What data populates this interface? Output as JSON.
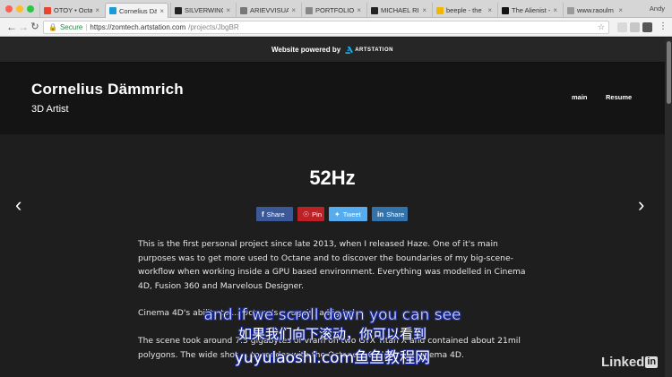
{
  "browser": {
    "tabs": [
      {
        "label": "OTOY • Octa",
        "favicon_color": "#e8452c"
      },
      {
        "label": "Cornelius Dä",
        "favicon_color": "#1b9cd8"
      },
      {
        "label": "SILVERWING",
        "favicon_color": "#222222"
      },
      {
        "label": "ARIEVVISUAL",
        "favicon_color": "#777777"
      },
      {
        "label": "PORTFOLIO",
        "favicon_color": "#888888"
      },
      {
        "label": "MICHAEL RIC",
        "favicon_color": "#222222"
      },
      {
        "label": "beeple - the",
        "favicon_color": "#f2b705"
      },
      {
        "label": "The Alienist -",
        "favicon_color": "#111111"
      },
      {
        "label": "www.raoulm",
        "favicon_color": "#9a9a9a"
      }
    ],
    "user": "Andy",
    "secure_label": "Secure",
    "url_main": "https://zomtech.artstation.com",
    "url_rest": "/projects/JbgBR"
  },
  "banner": {
    "text": "Website powered by",
    "brand": "ARTSTATION"
  },
  "site": {
    "name": "Cornelius Dämmrich",
    "subtitle": "3D Artist",
    "nav": {
      "main": "main",
      "resume": "Resume"
    }
  },
  "project": {
    "title": "52Hz",
    "share": {
      "facebook": "Share",
      "pinterest": "Pin",
      "twitter": "Tweet",
      "linkedin": "Share"
    },
    "paragraphs": [
      "This is the first personal project since late 2013, when I released Haze. One of it's main purposes was to get more used to Octane and to discover the boundaries of my big-scene-workflow when working inside a GPU based environment. Everything was modelled in Cinema 4D, Fusion 360 and Marvelous Designer.",
      "Cinema 4D's ability to ... Octane's ... again, a big help.",
      "The scene took around 7.5 gigabytes of vram on two GTX Titan X and contained about 21mil polygons. The wide shot ... to render with the Octane 3.0 Alpha for Cinema 4D."
    ]
  },
  "overlay": {
    "subtitle_en": "and if we scroll down you can see",
    "subtitle_cn": "如果我们向下滚动，你可以看到",
    "watermark": "yuyulaoshi.com鱼鱼教程网",
    "linkedin_text": "Linked",
    "linkedin_box": "in"
  },
  "colors": {
    "facebook": "#3b5998",
    "pinterest": "#bd2126",
    "twitter": "#55acee",
    "linkedin": "#3273ac",
    "secure": "#1e8e3e"
  }
}
